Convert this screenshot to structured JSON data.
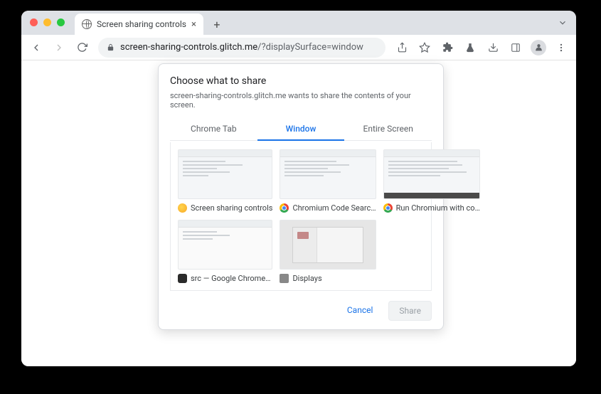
{
  "browser": {
    "tab_title": "Screen sharing controls",
    "url_host": "screen-sharing-controls.glitch.me",
    "url_path": "/?displaySurface=window"
  },
  "modal": {
    "title": "Choose what to share",
    "subtitle": "screen-sharing-controls.glitch.me wants to share the contents of your screen.",
    "tabs": {
      "chrome_tab": "Chrome Tab",
      "window": "Window",
      "entire_screen": "Entire Screen"
    },
    "items": [
      {
        "label": "Screen sharing controls",
        "favicon": "yellow"
      },
      {
        "label": "Chromium Code Searc…",
        "favicon": "chrome"
      },
      {
        "label": "Run Chromium with co…",
        "favicon": "chrome"
      },
      {
        "label": "src — Google Chrome…",
        "favicon": "dark"
      },
      {
        "label": "Displays",
        "favicon": "gray"
      }
    ],
    "cancel_label": "Cancel",
    "share_label": "Share"
  }
}
